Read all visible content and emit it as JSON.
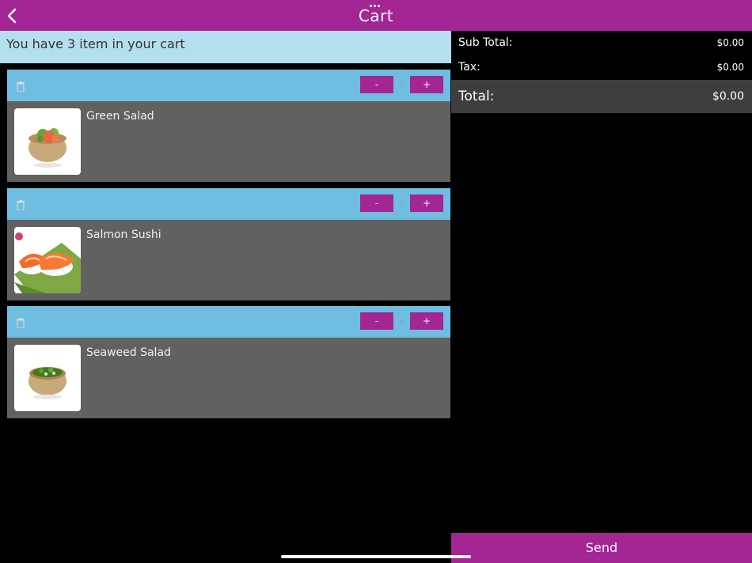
{
  "header": {
    "title": "Cart",
    "back_icon": "chevron-left-icon",
    "handle_icon": "more-dots-icon",
    "color": "#a32694"
  },
  "cart_summary": {
    "text": "You have 3 item in your cart"
  },
  "items": [
    {
      "name": "Green Salad",
      "quantity": "1",
      "minus_label": "-",
      "plus_label": "+",
      "image_icon": "green-salad-bowl-image"
    },
    {
      "name": "Salmon Sushi",
      "quantity": "1",
      "minus_label": "-",
      "plus_label": "+",
      "image_icon": "salmon-sushi-image"
    },
    {
      "name": "Seaweed Salad",
      "quantity": "1",
      "minus_label": "-",
      "plus_label": "+",
      "image_icon": "seaweed-salad-bowl-image"
    }
  ],
  "totals": {
    "subtotal_label": "Sub Total:",
    "subtotal_value": "$0.00",
    "tax_label": "Tax:",
    "tax_value": "$0.00",
    "total_label": "Total:",
    "total_value": "$0.00"
  },
  "send_label": "Send",
  "colors": {
    "accent": "#a32694",
    "item_bar": "#6fbde0",
    "summary_bar": "#b4dfee",
    "item_body": "#616161"
  }
}
